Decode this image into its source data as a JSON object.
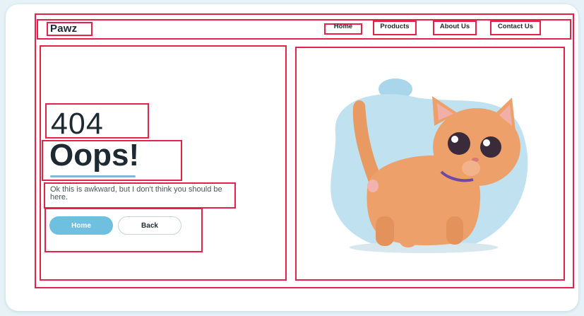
{
  "brand": {
    "name": "Pawz"
  },
  "nav": {
    "items": [
      {
        "label": "Home"
      },
      {
        "label": "Products"
      },
      {
        "label": "About Us"
      },
      {
        "label": "Contact Us"
      }
    ]
  },
  "main": {
    "error_code": "404",
    "title": "Oops!",
    "message": "Ok this is awkward, but I don't think you should be here.",
    "buttons": {
      "home_label": "Home",
      "back_label": "Back"
    }
  },
  "colors": {
    "accent": "#6fbfe0",
    "highlight_border": "#e3234a",
    "text_dark": "#1e2a32"
  },
  "illustration": {
    "icon": "cat-illustration"
  }
}
